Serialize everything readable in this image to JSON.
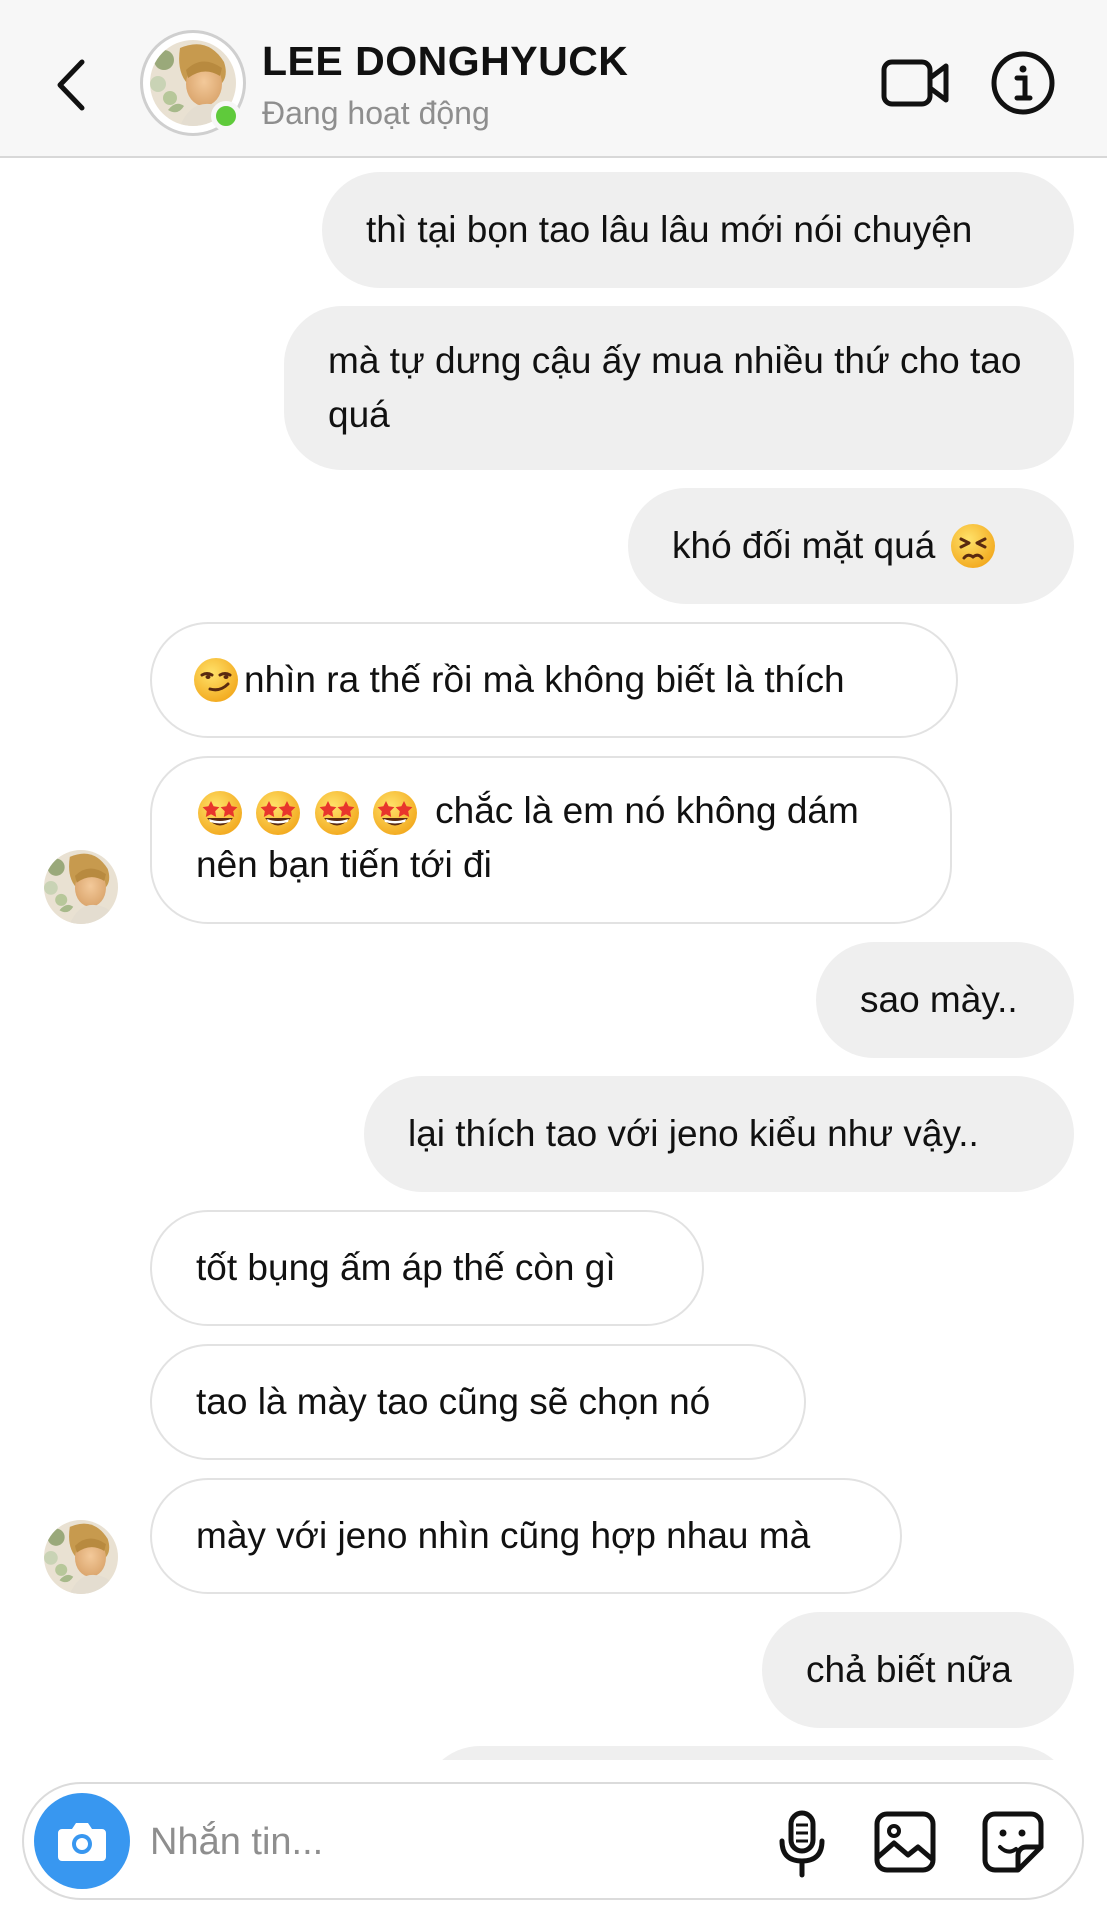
{
  "header": {
    "contact_name": "LEE DONGHYUCK",
    "status": "Đang hoạt động",
    "back_icon": "chevron-left-icon",
    "video_icon": "video-camera-icon",
    "info_icon": "info-icon"
  },
  "messages": [
    {
      "dir": "out",
      "text": "thì tại bọn tao lâu lâu mới nói chuyện"
    },
    {
      "dir": "out",
      "text": "mà tự dưng cậu ấy mua nhiều thứ cho tao quá"
    },
    {
      "dir": "out",
      "text": "khó đối mặt quá",
      "emoji": "persevering-face"
    },
    {
      "dir": "in",
      "text": "nhìn ra thế rồi mà không biết là thích",
      "emoji": "smirking-face"
    },
    {
      "dir": "in",
      "text": "chắc là em nó không dám nên bạn tiến tới đi",
      "emoji": "star-struck x4"
    },
    {
      "dir": "out",
      "text": "sao mày.."
    },
    {
      "dir": "out",
      "text": "lại thích tao với jeno kiểu như vậy.."
    },
    {
      "dir": "in",
      "text": "tốt bụng ấm áp thế còn gì"
    },
    {
      "dir": "in",
      "text": "tao là mày tao cũng sẽ chọn nó"
    },
    {
      "dir": "in",
      "text": "mày với jeno nhìn cũng hợp nhau mà"
    },
    {
      "dir": "out",
      "text": "chả biết nữa"
    }
  ],
  "composer": {
    "placeholder": "Nhắn tin...",
    "camera_icon": "camera-icon",
    "mic_icon": "microphone-icon",
    "gallery_icon": "image-icon",
    "sticker_icon": "sticker-icon"
  },
  "colors": {
    "outgoing_bubble": "#efefef",
    "incoming_border": "#e2e2e2",
    "online": "#5fca3b",
    "camera_button": "#3897f0",
    "muted_text": "#8e8e8e"
  }
}
